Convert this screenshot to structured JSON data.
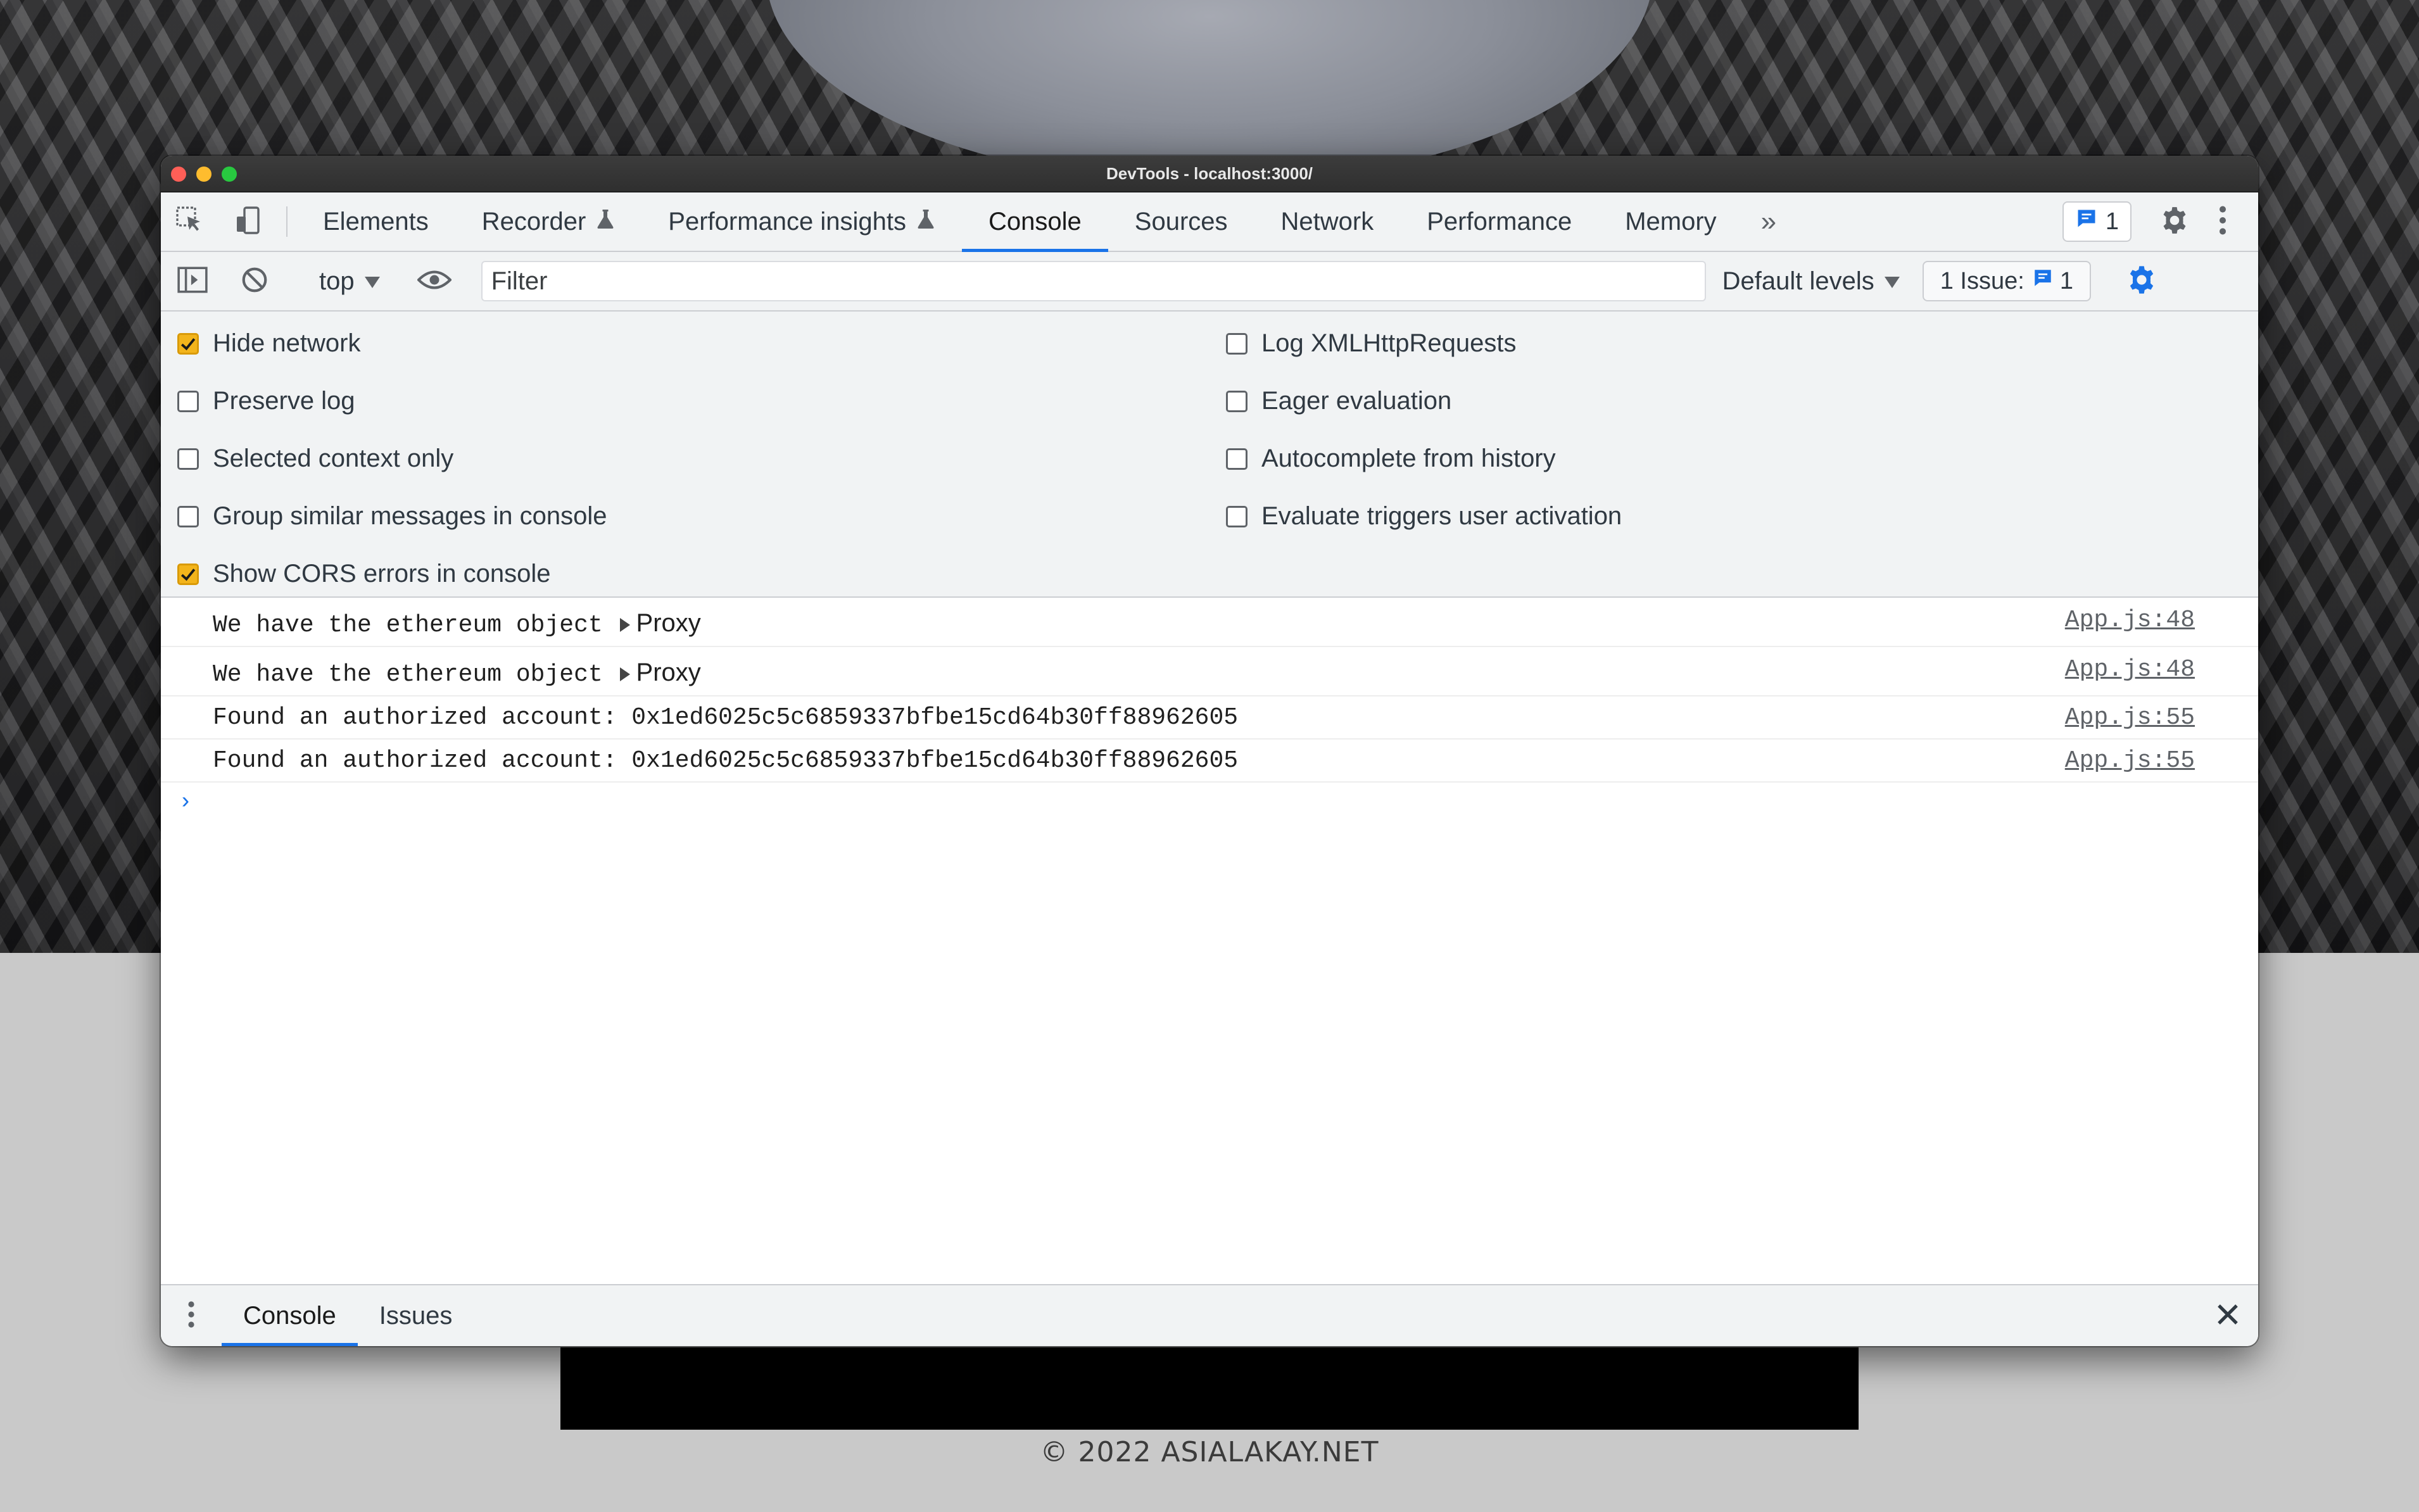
{
  "window": {
    "title": "DevTools - localhost:3000/"
  },
  "tabs": [
    {
      "label": "Elements"
    },
    {
      "label": "Recorder"
    },
    {
      "label": "Performance insights"
    },
    {
      "label": "Console"
    },
    {
      "label": "Sources"
    },
    {
      "label": "Network"
    },
    {
      "label": "Performance"
    },
    {
      "label": "Memory"
    }
  ],
  "active_tab": "Console",
  "toolbar": {
    "messages_badge": "1",
    "more_tabs": "»"
  },
  "console_toolbar": {
    "context": "top",
    "filter_placeholder": "Filter",
    "levels": "Default levels",
    "issues_label": "1 Issue:",
    "issues_count": "1"
  },
  "settings": {
    "left": [
      {
        "label": "Hide network",
        "checked": true
      },
      {
        "label": "Preserve log",
        "checked": false
      },
      {
        "label": "Selected context only",
        "checked": false
      },
      {
        "label": "Group similar messages in console",
        "checked": false
      },
      {
        "label": "Show CORS errors in console",
        "checked": true
      }
    ],
    "right": [
      {
        "label": "Log XMLHttpRequests",
        "checked": false
      },
      {
        "label": "Eager evaluation",
        "checked": false
      },
      {
        "label": "Autocomplete from history",
        "checked": false
      },
      {
        "label": "Evaluate triggers user activation",
        "checked": false
      }
    ]
  },
  "messages": [
    {
      "text": "We have the ethereum object ",
      "object": "Proxy",
      "source": "App.js:48"
    },
    {
      "text": "We have the ethereum object ",
      "object": "Proxy",
      "source": "App.js:48"
    },
    {
      "text": "Found an authorized account: 0x1ed6025c5c6859337bfbe15cd64b30ff88962605",
      "source": "App.js:55"
    },
    {
      "text": "Found an authorized account: 0x1ed6025c5c6859337bfbe15cd64b30ff88962605",
      "source": "App.js:55"
    }
  ],
  "console_prompt": "›",
  "drawer": {
    "tabs": [
      {
        "label": "Console"
      },
      {
        "label": "Issues"
      }
    ]
  },
  "page_footer": "© 2022 ASIALAKAY.NET",
  "colors": {
    "accent": "#1a73e8",
    "checkbox_checked": "#f3b41b"
  }
}
